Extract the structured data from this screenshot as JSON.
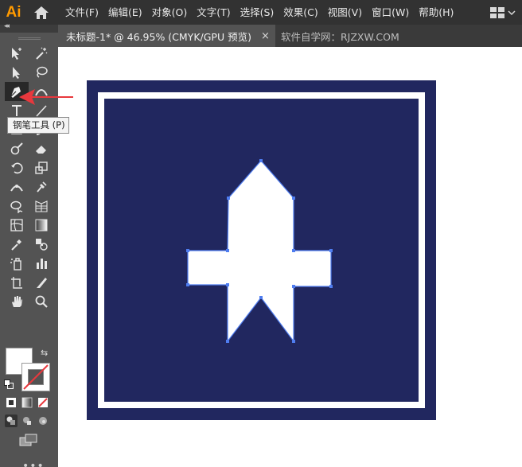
{
  "app": {
    "logo": "Ai"
  },
  "menu": [
    "文件(F)",
    "编辑(E)",
    "对象(O)",
    "文字(T)",
    "选择(S)",
    "效果(C)",
    "视图(V)",
    "窗口(W)",
    "帮助(H)"
  ],
  "tabs": {
    "active": "未标题-1* @ 46.95% (CMYK/GPU 预览)",
    "close": "×",
    "other": "软件自学网：RJZXW.COM"
  },
  "tooltip": "钢笔工具 (P)",
  "tools": [
    "artboard-selection-icon",
    "magic-wand-icon",
    "direct-selection-icon",
    "lasso-icon",
    "pen-tool-icon",
    "curvature-icon",
    "type-tool-icon",
    "line-segment-icon",
    "rectangle-icon",
    "paintbrush-icon",
    "shaper-icon",
    "eraser-icon",
    "rotate-icon",
    "scale-icon",
    "width-icon",
    "puppet-warp-icon",
    "shape-builder-icon",
    "perspective-grid-icon",
    "mesh-icon",
    "gradient-icon",
    "eyedropper-icon",
    "blend-icon",
    "symbol-sprayer-icon",
    "column-graph-icon",
    "artboard-icon",
    "slice-icon",
    "hand-icon",
    "zoom-icon"
  ],
  "colors": {
    "fill": "#ffffff",
    "stroke": "none",
    "artwork_background": "#21275f",
    "artwork_frame": "#ffffff",
    "path_selection": "#4f7df0",
    "arrow": "#e8383d"
  },
  "more_label": "•••"
}
